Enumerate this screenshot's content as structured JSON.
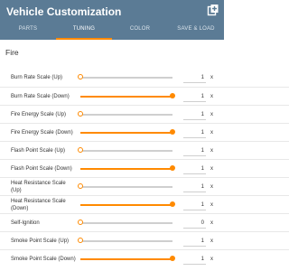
{
  "header": {
    "title": "Vehicle Customization",
    "icon": "copy-icon"
  },
  "tabs": [
    {
      "label": "PARTS",
      "active": false
    },
    {
      "label": "TUNING",
      "active": true
    },
    {
      "label": "COLOR",
      "active": false
    },
    {
      "label": "SAVE & LOAD",
      "active": false
    }
  ],
  "section": {
    "title": "Fire"
  },
  "accent_color": "#ff8a00",
  "rows": [
    {
      "label": "Burn Rate Scale (Up)",
      "value": "1",
      "unit": "x",
      "level": 0
    },
    {
      "label": "Burn Rate Scale (Down)",
      "value": "1",
      "unit": "x",
      "level": 1
    },
    {
      "label": "Fire Energy Scale (Up)",
      "value": "1",
      "unit": "x",
      "level": 0
    },
    {
      "label": "Fire Energy Scale (Down)",
      "value": "1",
      "unit": "x",
      "level": 1
    },
    {
      "label": "Flash Point Scale (Up)",
      "value": "1",
      "unit": "x",
      "level": 0
    },
    {
      "label": "Flash Point Scale (Down)",
      "value": "1",
      "unit": "x",
      "level": 1
    },
    {
      "label": "Heat Resistance Scale (Up)",
      "value": "1",
      "unit": "x",
      "level": 0
    },
    {
      "label": "Heat Resistance Scale (Down)",
      "value": "1",
      "unit": "x",
      "level": 1
    },
    {
      "label": "Self-Ignition",
      "value": "0",
      "unit": "x",
      "level": 0
    },
    {
      "label": "Smoke Point Scale (Up)",
      "value": "1",
      "unit": "x",
      "level": 0
    },
    {
      "label": "Smoke Point Scale (Down)",
      "value": "1",
      "unit": "x",
      "level": 1
    }
  ]
}
